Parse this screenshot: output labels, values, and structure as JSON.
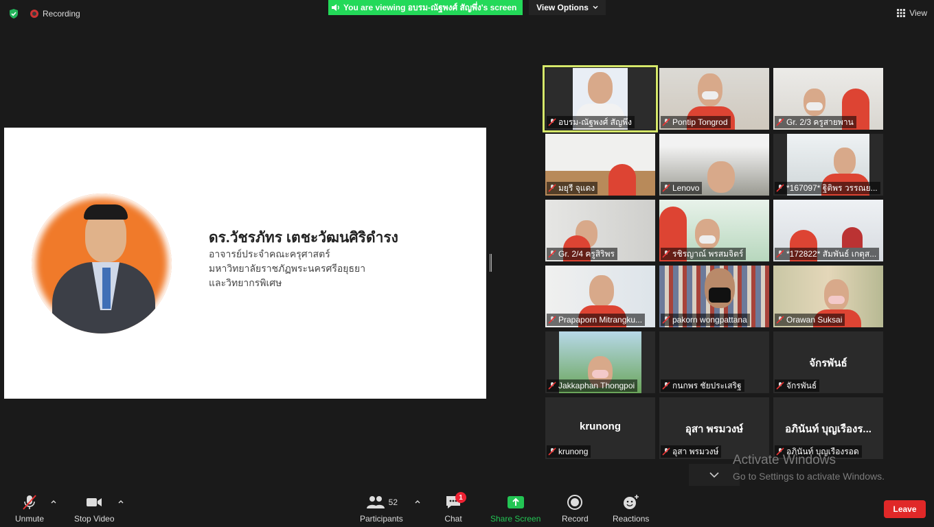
{
  "top": {
    "recording_label": "Recording",
    "viewing_banner": "You are viewing อบรม-ณัฐพงศ์ สัญพึ่ง's screen",
    "view_options_label": "View Options",
    "view_label": "View"
  },
  "slide": {
    "name": "ดร.วัชรภัทร  เตชะวัฒนศิริดำรง",
    "line1": "อาจารย์ประจำคณะครุศาสตร์",
    "line2": "มหาวิทยาลัยราชภัฏพระนครศรีอยุธยา",
    "line3": "และวิทยากรพิเศษ"
  },
  "participants": [
    {
      "name": "อบรม-ณัฐพงศ์ สัญพึ่ง"
    },
    {
      "name": "Pontip Tongrod"
    },
    {
      "name": "Gr. 2/3 ครูสายพาน"
    },
    {
      "name": "มยุรี จุแดง"
    },
    {
      "name": "Lenovo"
    },
    {
      "name": "*167097* ฐิติพร วรรณย..."
    },
    {
      "name": "Gr. 2/4 ครูสิริพร"
    },
    {
      "name": "รชิรญาณ์ พรสมจิตร์"
    },
    {
      "name": "*172822* สัมพันธ์ เกตุส..."
    },
    {
      "name": "Prapaporn Mitrangku..."
    },
    {
      "name": "pakorn wongpattana"
    },
    {
      "name": "Orawan Suksai"
    },
    {
      "name": "Jakkaphan Thongpoi"
    },
    {
      "name": "กนกพร ชัยประเสริฐ"
    },
    {
      "name": "จักรพันธ์",
      "big": "จักรพันธ์"
    },
    {
      "name": "krunong",
      "big": "krunong"
    },
    {
      "name": "อุสา พรมวงษ์",
      "big": "อุสา พรมวงษ์"
    },
    {
      "name": "อภินันท์ บุญเรืองรอด",
      "big": "อภินันท์ บุญเรืองร..."
    }
  ],
  "watermark": {
    "title": "Activate Windows",
    "subtitle": "Go to Settings to activate Windows."
  },
  "toolbar": {
    "unmute": "Unmute",
    "stop_video": "Stop Video",
    "participants": "Participants",
    "participants_count": "52",
    "chat": "Chat",
    "chat_badge": "1",
    "share_screen": "Share Screen",
    "record": "Record",
    "reactions": "Reactions",
    "leave": "Leave"
  }
}
